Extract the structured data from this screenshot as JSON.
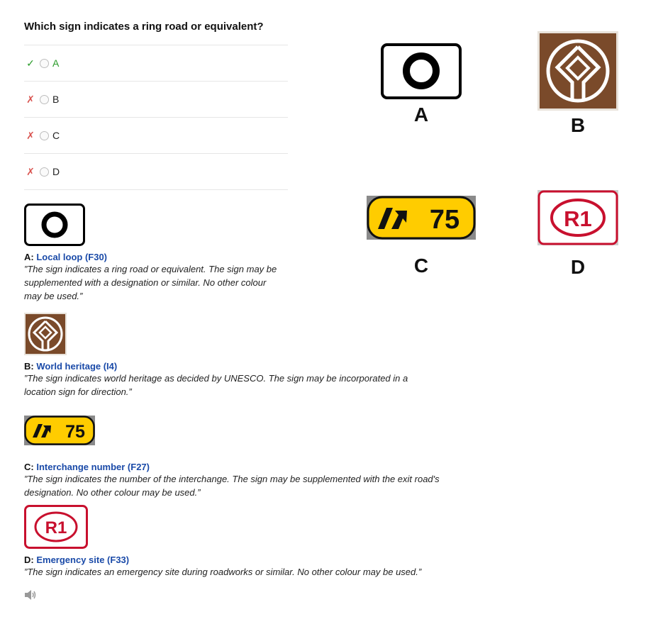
{
  "question": "Which sign indicates a ring road or equivalent?",
  "options": [
    {
      "mark": "✓",
      "label": "A"
    },
    {
      "mark": "✗",
      "label": "B"
    },
    {
      "mark": "✗",
      "label": "C"
    },
    {
      "mark": "✗",
      "label": "D"
    }
  ],
  "explanations": [
    {
      "prefix": "A: ",
      "link": "Local loop (F30)",
      "text": "”The sign indicates a ring road or equivalent. The sign may be supplemented with a designation or similar. No other colour may be used.”"
    },
    {
      "prefix": "B: ",
      "link": "World heritage (I4)",
      "text": "”The sign indicates world heritage as decided by UNESCO. The sign may be incorporated in a location sign for direction.”"
    },
    {
      "prefix": "C: ",
      "link": "Interchange number (F27)",
      "text": "”The sign indicates the number of the interchange. The sign may be supplemented with the exit road's designation. No other colour may be used.”"
    },
    {
      "prefix": "D: ",
      "link": "Emergency site (F33)",
      "text": "”The sign indicates an emergency site during roadworks or similar. No other colour may be used.”"
    }
  ],
  "signs": {
    "interchange_number": "75",
    "emergency_code": "R1"
  },
  "big_labels": [
    "A",
    "B",
    "C",
    "D"
  ],
  "colors": {
    "correct": "#2a9c2a",
    "wrong": "#d9534f",
    "link": "#1a4aa8",
    "heritage_brown": "#7a4a2a",
    "interchange_yellow": "#ffcc00",
    "emergency_red": "#c8102e"
  },
  "icons": {
    "speaker": "speaker-icon"
  }
}
